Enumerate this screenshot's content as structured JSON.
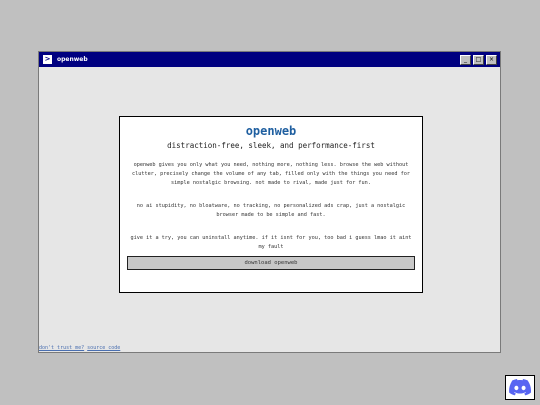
{
  "window": {
    "title": "openweb",
    "app_icon_glyph": ">",
    "controls": {
      "minimize": "_",
      "maximize": "□",
      "close": "×"
    }
  },
  "card": {
    "title": "openweb",
    "subtitle": "distraction-free, sleek, and performance-first",
    "paragraphs": [
      "openweb gives you only what you need, nothing more, nothing less. browse the web without clutter, precisely change the volume of any tab, filled only with the things you need for simple nostalgic browsing. not made to rival, made just for fun.",
      "no ai stupidity, no bloatware, no tracking, no personalized ads crap, just a nostalgic browser made to be simple and fast.",
      "give it a try, you can uninstall anytime. if it isnt for you, too bad i guess lmao it aint my fault"
    ],
    "download_label": "download openweb"
  },
  "footer": {
    "links": [
      "don't trust me?",
      "source code"
    ]
  },
  "colors": {
    "titlebar": "#000080",
    "title_accent": "#1f5fa0",
    "discord": "#5865F2"
  },
  "icons": {
    "discord": "discord-icon"
  }
}
